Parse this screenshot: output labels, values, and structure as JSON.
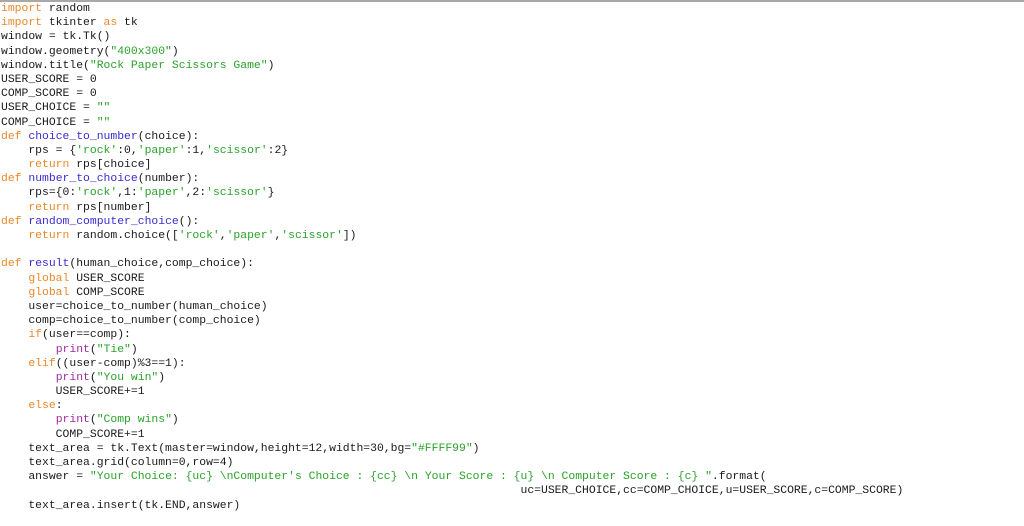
{
  "editor": {
    "language": "python",
    "colors": {
      "keyword": "#e8882a",
      "function_name": "#3a2bd0",
      "string": "#2aa22a",
      "builtin": "#a02aa0",
      "text": "#1a1a1a"
    },
    "lines": [
      [
        {
          "t": "kw",
          "s": "import"
        },
        {
          "t": "tx",
          "s": " random"
        }
      ],
      [
        {
          "t": "kw",
          "s": "import"
        },
        {
          "t": "tx",
          "s": " tkinter "
        },
        {
          "t": "kw",
          "s": "as"
        },
        {
          "t": "tx",
          "s": " tk"
        }
      ],
      [
        {
          "t": "tx",
          "s": "window = tk.Tk()"
        }
      ],
      [
        {
          "t": "tx",
          "s": "window.geometry("
        },
        {
          "t": "str",
          "s": "\"400x300\""
        },
        {
          "t": "tx",
          "s": ")"
        }
      ],
      [
        {
          "t": "tx",
          "s": "window.title("
        },
        {
          "t": "str",
          "s": "\"Rock Paper Scissors Game\""
        },
        {
          "t": "tx",
          "s": ")"
        }
      ],
      [
        {
          "t": "tx",
          "s": "USER_SCORE = 0"
        }
      ],
      [
        {
          "t": "tx",
          "s": "COMP_SCORE = 0"
        }
      ],
      [
        {
          "t": "tx",
          "s": "USER_CHOICE = "
        },
        {
          "t": "str",
          "s": "\"\""
        }
      ],
      [
        {
          "t": "tx",
          "s": "COMP_CHOICE = "
        },
        {
          "t": "str",
          "s": "\"\""
        }
      ],
      [
        {
          "t": "kw",
          "s": "def"
        },
        {
          "t": "tx",
          "s": " "
        },
        {
          "t": "fn",
          "s": "choice_to_number"
        },
        {
          "t": "tx",
          "s": "(choice):"
        }
      ],
      [
        {
          "t": "tx",
          "s": "    rps = {"
        },
        {
          "t": "str",
          "s": "'rock'"
        },
        {
          "t": "tx",
          "s": ":0,"
        },
        {
          "t": "str",
          "s": "'paper'"
        },
        {
          "t": "tx",
          "s": ":1,"
        },
        {
          "t": "str",
          "s": "'scissor'"
        },
        {
          "t": "tx",
          "s": ":2}"
        }
      ],
      [
        {
          "t": "tx",
          "s": "    "
        },
        {
          "t": "kw",
          "s": "return"
        },
        {
          "t": "tx",
          "s": " rps[choice]"
        }
      ],
      [
        {
          "t": "kw",
          "s": "def"
        },
        {
          "t": "tx",
          "s": " "
        },
        {
          "t": "fn",
          "s": "number_to_choice"
        },
        {
          "t": "tx",
          "s": "(number):"
        }
      ],
      [
        {
          "t": "tx",
          "s": "    rps={0:"
        },
        {
          "t": "str",
          "s": "'rock'"
        },
        {
          "t": "tx",
          "s": ",1:"
        },
        {
          "t": "str",
          "s": "'paper'"
        },
        {
          "t": "tx",
          "s": ",2:"
        },
        {
          "t": "str",
          "s": "'scissor'"
        },
        {
          "t": "tx",
          "s": "}"
        }
      ],
      [
        {
          "t": "tx",
          "s": "    "
        },
        {
          "t": "kw",
          "s": "return"
        },
        {
          "t": "tx",
          "s": " rps[number]"
        }
      ],
      [
        {
          "t": "kw",
          "s": "def"
        },
        {
          "t": "tx",
          "s": " "
        },
        {
          "t": "fn",
          "s": "random_computer_choice"
        },
        {
          "t": "tx",
          "s": "():"
        }
      ],
      [
        {
          "t": "tx",
          "s": "    "
        },
        {
          "t": "kw",
          "s": "return"
        },
        {
          "t": "tx",
          "s": " random.choice(["
        },
        {
          "t": "str",
          "s": "'rock'"
        },
        {
          "t": "tx",
          "s": ","
        },
        {
          "t": "str",
          "s": "'paper'"
        },
        {
          "t": "tx",
          "s": ","
        },
        {
          "t": "str",
          "s": "'scissor'"
        },
        {
          "t": "tx",
          "s": "])"
        }
      ],
      [],
      [
        {
          "t": "kw",
          "s": "def"
        },
        {
          "t": "tx",
          "s": " "
        },
        {
          "t": "fn",
          "s": "result"
        },
        {
          "t": "tx",
          "s": "(human_choice,comp_choice):"
        }
      ],
      [
        {
          "t": "tx",
          "s": "    "
        },
        {
          "t": "kw",
          "s": "global"
        },
        {
          "t": "tx",
          "s": " USER_SCORE"
        }
      ],
      [
        {
          "t": "tx",
          "s": "    "
        },
        {
          "t": "kw",
          "s": "global"
        },
        {
          "t": "tx",
          "s": " COMP_SCORE"
        }
      ],
      [
        {
          "t": "tx",
          "s": "    user=choice_to_number(human_choice)"
        }
      ],
      [
        {
          "t": "tx",
          "s": "    comp=choice_to_number(comp_choice)"
        }
      ],
      [
        {
          "t": "tx",
          "s": "    "
        },
        {
          "t": "kw",
          "s": "if"
        },
        {
          "t": "tx",
          "s": "(user==comp):"
        }
      ],
      [
        {
          "t": "tx",
          "s": "        "
        },
        {
          "t": "bi",
          "s": "print"
        },
        {
          "t": "tx",
          "s": "("
        },
        {
          "t": "str",
          "s": "\"Tie\""
        },
        {
          "t": "tx",
          "s": ")"
        }
      ],
      [
        {
          "t": "tx",
          "s": "    "
        },
        {
          "t": "kw",
          "s": "elif"
        },
        {
          "t": "tx",
          "s": "((user-comp)%3==1):"
        }
      ],
      [
        {
          "t": "tx",
          "s": "        "
        },
        {
          "t": "bi",
          "s": "print"
        },
        {
          "t": "tx",
          "s": "("
        },
        {
          "t": "str",
          "s": "\"You win\""
        },
        {
          "t": "tx",
          "s": ")"
        }
      ],
      [
        {
          "t": "tx",
          "s": "        USER_SCORE+=1"
        }
      ],
      [
        {
          "t": "tx",
          "s": "    "
        },
        {
          "t": "kw",
          "s": "else"
        },
        {
          "t": "tx",
          "s": ":"
        }
      ],
      [
        {
          "t": "tx",
          "s": "        "
        },
        {
          "t": "bi",
          "s": "print"
        },
        {
          "t": "tx",
          "s": "("
        },
        {
          "t": "str",
          "s": "\"Comp wins\""
        },
        {
          "t": "tx",
          "s": ")"
        }
      ],
      [
        {
          "t": "tx",
          "s": "        COMP_SCORE+=1"
        }
      ],
      [
        {
          "t": "tx",
          "s": "    text_area = tk.Text(master=window,height=12,width=30,bg="
        },
        {
          "t": "str",
          "s": "\"#FFFF99\""
        },
        {
          "t": "tx",
          "s": ")"
        }
      ],
      [
        {
          "t": "tx",
          "s": "    text_area.grid(column=0,row=4)"
        }
      ],
      [
        {
          "t": "tx",
          "s": "    answer = "
        },
        {
          "t": "str",
          "s": "\"Your Choice: {uc} \\nComputer's Choice : {cc} \\n Your Score : {u} \\n Computer Score : {c} \""
        },
        {
          "t": "tx",
          "s": ".format("
        }
      ],
      [
        {
          "t": "tx",
          "s": "                                                                            uc=USER_CHOICE,cc=COMP_CHOICE,u=USER_SCORE,c=COMP_SCORE)"
        }
      ],
      [
        {
          "t": "tx",
          "s": "    text_area.insert(tk.END,answer)"
        }
      ]
    ]
  }
}
